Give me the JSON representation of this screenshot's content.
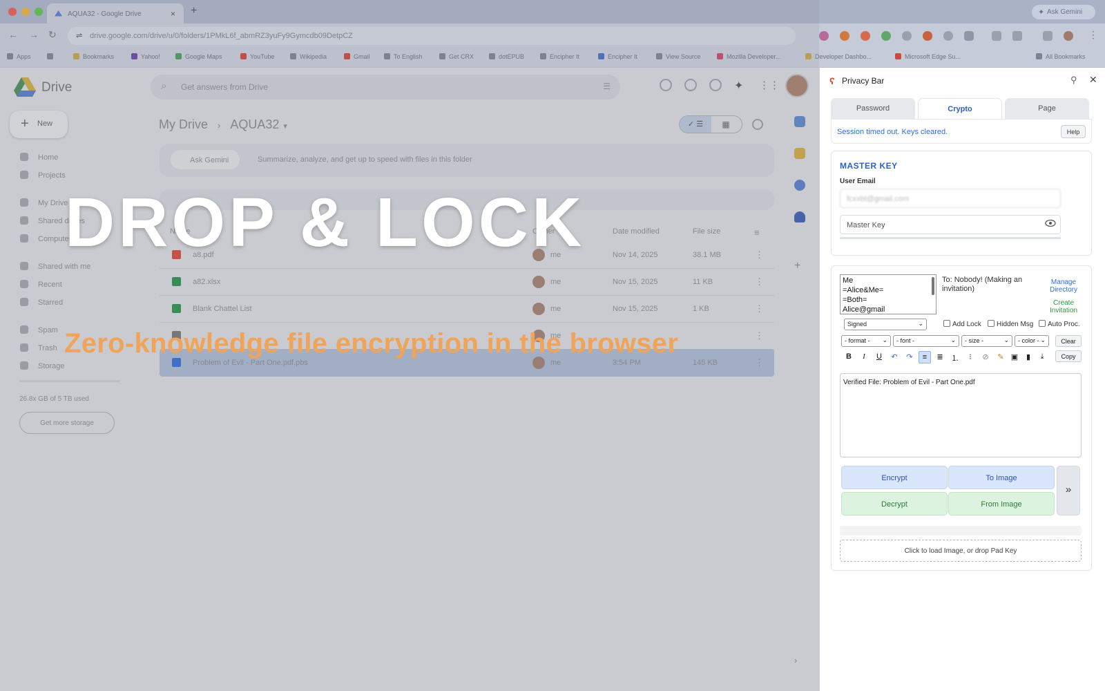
{
  "browser": {
    "tab_title": "AQUA32 - Google Drive",
    "url": "drive.google.com/drive/u/0/folders/1PMkL6f_abmRZ3yuFy9Gymcdb09DetpCZ",
    "ask_gemini": "Ask Gemini",
    "bookmarks": [
      "Apps",
      "Bookmarks",
      "Yahoo!",
      "Google Maps",
      "YouTube",
      "Wikipedia",
      "Gmail",
      "To English",
      "Get CRX",
      "dotEPUB",
      "Encipher It",
      "Encipher It",
      "View Source",
      "Mozilla Developer...",
      "Developer Dashbo...",
      "Microsoft Edge Su...",
      "All Bookmarks"
    ]
  },
  "drive": {
    "logo_text": "Drive",
    "search_placeholder": "Get answers from Drive",
    "new_label": "New",
    "nav": [
      "Home",
      "Projects",
      "My Drive",
      "Shared drives",
      "Computers",
      "Shared with me",
      "Recent",
      "Starred",
      "Spam",
      "Trash",
      "Storage"
    ],
    "storage_text": "26.8x GB of 5 TB used",
    "get_storage": "Get more storage",
    "crumb_root": "My Drive",
    "crumb_folder": "AQUA32",
    "gemini_chip": "Ask Gemini",
    "gemini_text": "Summarize, analyze, and get up to speed with files in this folder",
    "columns": {
      "name": "Name",
      "owner": "Owner",
      "modified": "Date modified",
      "size": "File size"
    },
    "files": [
      {
        "name": "a8.pdf",
        "owner": "me",
        "date": "Nov 14, 2025",
        "size": "38.1 MB",
        "color": "#d14b3f"
      },
      {
        "name": "a82.xlsx",
        "owner": "me",
        "date": "Nov 15, 2025",
        "size": "11 KB",
        "color": "#2f8f4f"
      },
      {
        "name": "Blank Chattel List",
        "owner": "me",
        "date": "Nov 15, 2025",
        "size": "1 KB",
        "color": "#2f8f4f"
      },
      {
        "name": "",
        "owner": "me",
        "date": "",
        "size": "",
        "color": "#777"
      },
      {
        "name": "Problem of Evil - Part One.pdf.pbs",
        "owner": "me",
        "date": "3:54 PM",
        "size": "145 KB",
        "color": "#3a6ed0"
      }
    ]
  },
  "overlay": {
    "headline": "DROP & LOCK",
    "subline": "Zero-knowledge file encryption in the browser"
  },
  "panel": {
    "title": "Privacy Bar",
    "tabs": [
      "Password",
      "Crypto",
      "Page"
    ],
    "active_tab": "Crypto",
    "status": "Session timed out. Keys cleared.",
    "help": "Help",
    "master_key_title": "MASTER KEY",
    "user_email_label": "User Email",
    "user_email_value": "fcxxbt@gmail.com",
    "master_key_placeholder": "Master Key",
    "recipients": [
      "Me",
      "=Alice&Me=",
      "=Both=",
      "Alice@gmail"
    ],
    "to_text": "To: Nobody! (Making an invitation)",
    "manage_directory": "Manage Directory",
    "create_invitation": "Create Invitation",
    "mode": "Signed",
    "checkboxes": [
      "Add Lock",
      "Hidden Msg",
      "Auto Proc."
    ],
    "format": "- format -",
    "font": "- font -",
    "size": "- size -",
    "color": "- color -",
    "clear": "Clear",
    "copy": "Copy",
    "text": "Verified File: Problem of Evil - Part One.pdf",
    "encrypt": "Encrypt",
    "to_image": "To Image",
    "decrypt": "Decrypt",
    "from_image": "From Image",
    "more": "»",
    "drop_hint": "Click to load Image, or drop Pad Key",
    "colors": {
      "accent": "#2a5fd6",
      "green": "#2e7b3c",
      "logo": "#d9482f"
    }
  }
}
